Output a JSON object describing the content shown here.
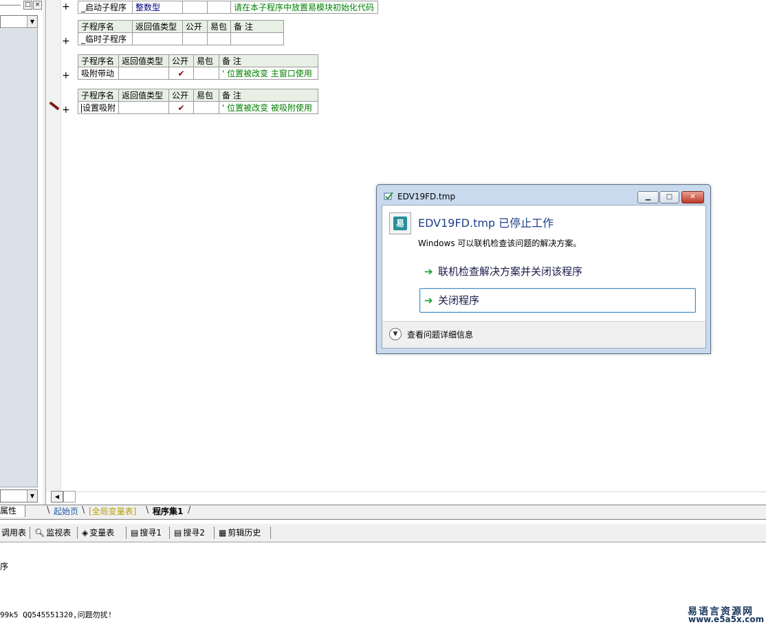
{
  "left_panel": {
    "props_tab": "属性"
  },
  "tables": [
    {
      "row": {
        "name": "_启动子程序",
        "ret": "整数型",
        "pub": "",
        "pkg": "",
        "note": "请在本子程序中放置易模块初始化代码"
      }
    },
    {
      "header": {
        "name": "子程序名",
        "ret": "返回值类型",
        "pub": "公开",
        "pkg": "易包",
        "note": "备 注"
      },
      "row": {
        "name": "_临时子程序",
        "ret": "",
        "pub": "",
        "pkg": "",
        "note": ""
      }
    },
    {
      "header": {
        "name": "子程序名",
        "ret": "返回值类型",
        "pub": "公开",
        "pkg": "易包",
        "note": "备 注"
      },
      "row": {
        "name": "吸附带动",
        "ret": "",
        "pub": "✔",
        "pkg": "",
        "note": "' 位置被改变  主窗口使用"
      }
    },
    {
      "header": {
        "name": "子程序名",
        "ret": "返回值类型",
        "pub": "公开",
        "pkg": "易包",
        "note": "备 注"
      },
      "row": {
        "name": "设置吸附",
        "ret": "",
        "pub": "✔",
        "pkg": "",
        "note": "' 位置被改变  被吸附使用"
      }
    }
  ],
  "gutter": {
    "plus": "+"
  },
  "tabs": {
    "start": "起始页",
    "global": "[全局变量表]",
    "prog": "程序集1"
  },
  "toolbar": {
    "items": [
      {
        "label": "调用表",
        "icon": "call-table-icon"
      },
      {
        "label": "监视表",
        "icon": "magnifier-icon"
      },
      {
        "label": "变量表",
        "icon": "variables-icon"
      },
      {
        "label": "搜寻1",
        "icon": "search-doc-icon"
      },
      {
        "label": "搜寻2",
        "icon": "search-doc-icon"
      },
      {
        "label": "剪辑历史",
        "icon": "clipboard-icon"
      }
    ]
  },
  "output": {
    "line1": "序",
    "line2": "99k5 QQ545551320,问题勿扰!"
  },
  "watermark": {
    "cn": "易语言资源网",
    "url": "www.e5a5x.com"
  },
  "dialog": {
    "title": "EDV19FD.tmp",
    "heading": "EDV19FD.tmp 已停止工作",
    "message": "Windows 可以联机检查该问题的解决方案。",
    "option1": "联机检查解决方案并关闭该程序",
    "option2": "关闭程序",
    "details": "查看问题详细信息",
    "app_icon_text": "易"
  },
  "colors": {
    "comment_green": "#008000",
    "tab_blue": "#1e5aa8",
    "dialog_heading": "#1e3f8a",
    "arrow_green": "#1a9d3a"
  }
}
